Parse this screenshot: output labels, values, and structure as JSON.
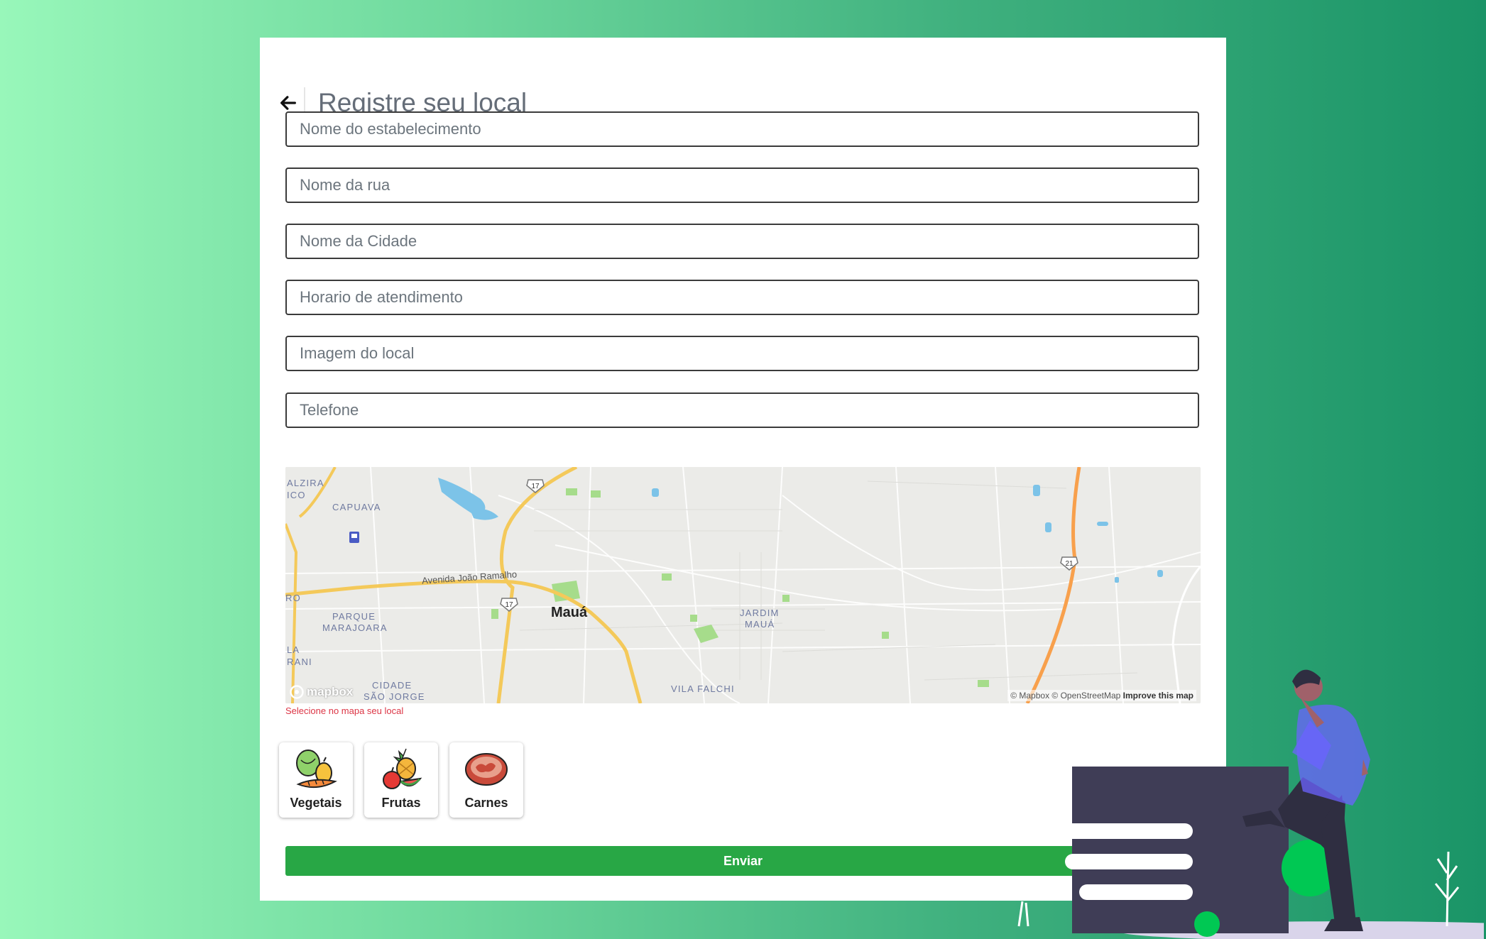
{
  "header": {
    "title": "Registre seu local",
    "back_icon": "arrow-left-icon"
  },
  "form": {
    "fields": [
      {
        "name": "nome-estabelecimento",
        "placeholder": "Nome do estabelecimento",
        "value": ""
      },
      {
        "name": "nome-rua",
        "placeholder": "Nome da rua",
        "value": ""
      },
      {
        "name": "nome-cidade",
        "placeholder": "Nome da Cidade",
        "value": ""
      },
      {
        "name": "horario",
        "placeholder": "Horario de atendimento",
        "value": ""
      },
      {
        "name": "imagem",
        "placeholder": "Imagem do local",
        "value": ""
      },
      {
        "name": "telefone",
        "placeholder": "Telefone",
        "value": ""
      }
    ],
    "map_hint": "Selecione no mapa seu local",
    "submit_label": "Enviar"
  },
  "map": {
    "city": "Mauá",
    "labels": [
      "ALZIRA",
      "ICO",
      "CAPUAVA",
      "PARQUE",
      "MARAJOARA",
      "JARDIM",
      "MAUÁ",
      "LA",
      "RANI",
      "CIDADE",
      "SÃO JORGE",
      "VILA FALCHI",
      "RO"
    ],
    "road_name": "Avenida João Ramalho",
    "shields": [
      "17",
      "17",
      "21"
    ],
    "logo": "mapbox",
    "attribution": "© Mapbox © OpenStreetMap",
    "improve_link": "Improve this map"
  },
  "categories": [
    {
      "label": "Vegetais",
      "icon": "vegetables-icon"
    },
    {
      "label": "Frutas",
      "icon": "fruits-icon"
    },
    {
      "label": "Carnes",
      "icon": "meat-icon"
    }
  ],
  "colors": {
    "accent": "#28a745",
    "error": "#dc3545",
    "title": "#656d78"
  }
}
